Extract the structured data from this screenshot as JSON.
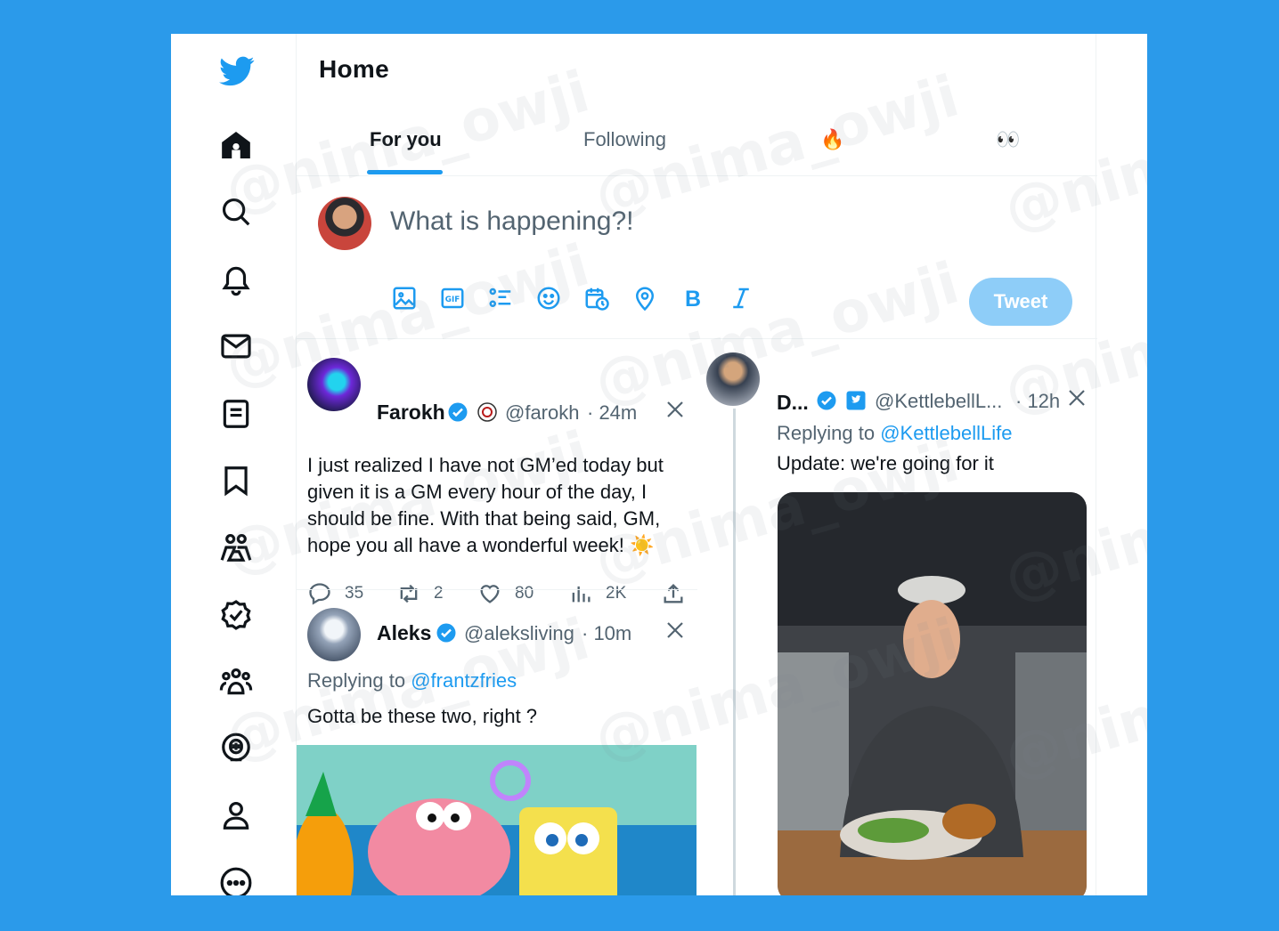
{
  "header": {
    "title": "Home"
  },
  "tabs": [
    {
      "label": "For you",
      "active": true
    },
    {
      "label": "Following",
      "active": false
    },
    {
      "label": "🔥",
      "active": false
    },
    {
      "label": "👀",
      "active": false
    }
  ],
  "composer": {
    "placeholder": "What is happening?!",
    "tools": [
      "image-icon",
      "gif-icon",
      "poll-icon",
      "emoji-icon",
      "schedule-icon",
      "location-icon",
      "bold-icon",
      "italic-icon"
    ],
    "tweet_button": "Tweet"
  },
  "sidebar": {
    "items": [
      "home-icon",
      "explore-icon",
      "notifications-icon",
      "messages-icon",
      "lists-icon",
      "bookmarks-icon",
      "communities-icon",
      "verified-icon",
      "people-icon",
      "spaces-icon",
      "profile-icon",
      "more-icon"
    ]
  },
  "tweets": [
    {
      "name": "Farokh",
      "handle": "@farokh",
      "time": "· 24m",
      "text": "I just realized I have not GM’ed today but given it is a GM every hour of the day, I should be fine. With that being said, GM, hope you all have a wonderful week! ☀️",
      "replies": "35",
      "retweets": "2",
      "likes": "80",
      "views": "2K"
    },
    {
      "name": "Aleks",
      "handle": "@aleksliving",
      "time": "· 10m",
      "replying_label": "Replying to",
      "replying_to": "@frantzfries",
      "text": "Gotta be these two, right ?"
    },
    {
      "name": "D...",
      "handle": "@KettlebellL...",
      "time": "· 12h",
      "replying_label": "Replying to",
      "replying_to": "@KettlebellLife",
      "text": "Update: we're going for it"
    }
  ],
  "watermark": "@nima_owji",
  "colors": {
    "accent": "#1d9bf0",
    "background": "#2b9aea",
    "tweet_button_disabled": "#8ecdf8"
  }
}
